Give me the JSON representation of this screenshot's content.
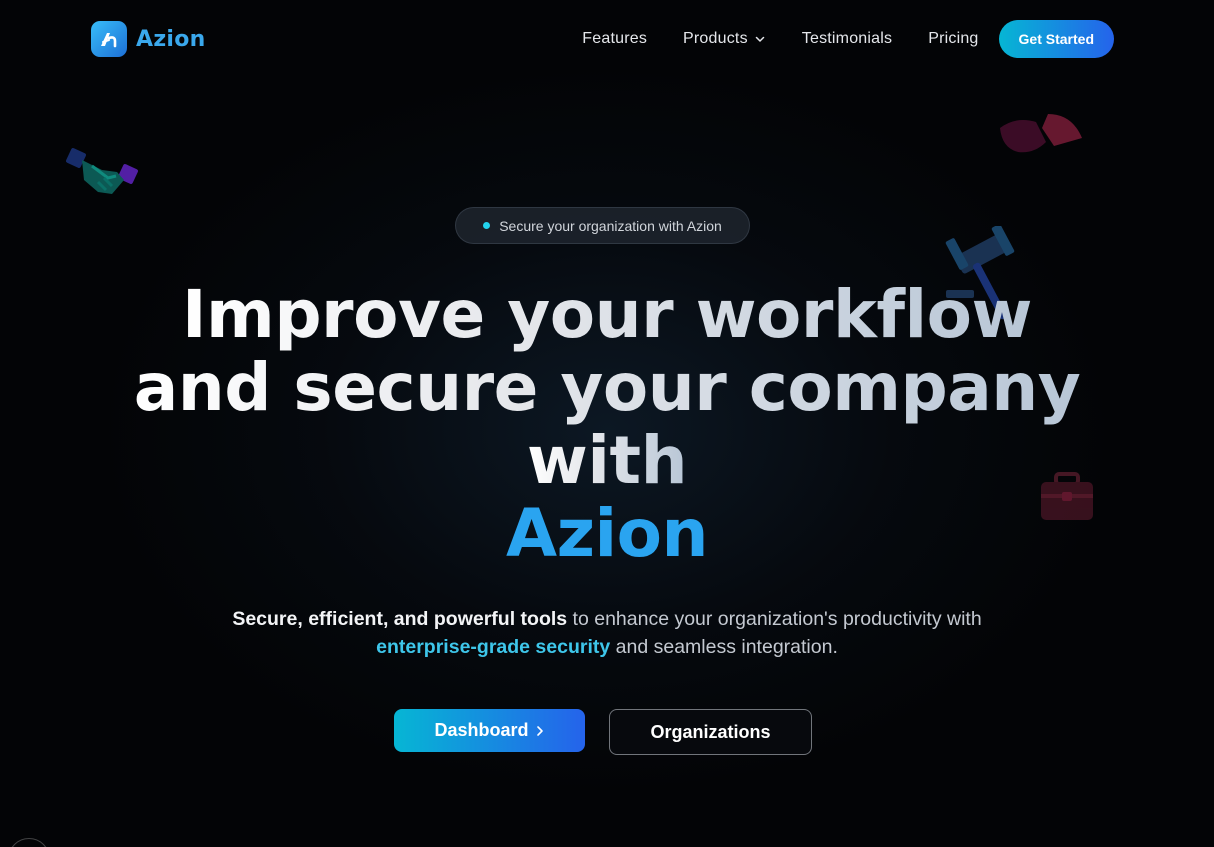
{
  "brand": {
    "name": "Azion",
    "logo_icon": "azion-logo-icon",
    "accent_color": "#2aa4f0"
  },
  "nav": {
    "links": [
      {
        "label": "Features"
      },
      {
        "label": "Products",
        "has_dropdown": true
      },
      {
        "label": "Testimonials"
      },
      {
        "label": "Pricing"
      }
    ],
    "cta_label": "Get Started"
  },
  "hero": {
    "badge_text": "Secure your organization with Azion",
    "headline_lines": [
      "Improve your workflow",
      "and secure your company",
      "with"
    ],
    "headline_brand": "Azion",
    "subtitle": {
      "strong": "Secure, efficient, and powerful tools",
      "part1": " to enhance your organization's productivity with ",
      "highlight": "enterprise-grade security",
      "part2": " and seamless integration."
    },
    "primary_button": "Dashboard",
    "secondary_button": "Organizations"
  },
  "decorations": [
    "handshake-icon",
    "pie-chart-icon",
    "gavel-icon",
    "briefcase-icon"
  ],
  "colors": {
    "gradient_start": "#06b6d4",
    "gradient_end": "#2563eb",
    "background": "#030406"
  }
}
